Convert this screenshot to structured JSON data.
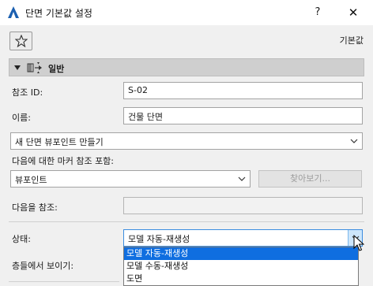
{
  "window": {
    "title": "단면 기본값 설정",
    "help_label": "?",
    "close_label": "✕"
  },
  "toolbar": {
    "favorites_icon": "star-icon",
    "default_label": "기본값"
  },
  "section": {
    "title": "일반",
    "icon": "section-tool-icon"
  },
  "form": {
    "ref_id_label": "참조 ID:",
    "ref_id_value": "S-02",
    "name_label": "이름:",
    "name_value": "건물 단면",
    "viewpoint_select": "새 단면 뷰포인트 만들기",
    "marker_ref_label": "다음에 대한 마커 참조 포함:",
    "marker_ref_select": "뷰포인트",
    "browse_button": "찾아보기...",
    "reference_label": "다음을 참조:",
    "reference_value": "",
    "status_label": "상태:",
    "status_value": "모델 자동-재생성",
    "show_on_stories_label": "층들에서 보이기:"
  },
  "status_options": [
    {
      "label": "모델 자동-재생성",
      "selected": true
    },
    {
      "label": "모델 수동-재생성",
      "selected": false
    },
    {
      "label": "도면",
      "selected": false
    }
  ],
  "colors": {
    "accent": "#0f6ee0",
    "app_icon": "#1b5fb0"
  }
}
